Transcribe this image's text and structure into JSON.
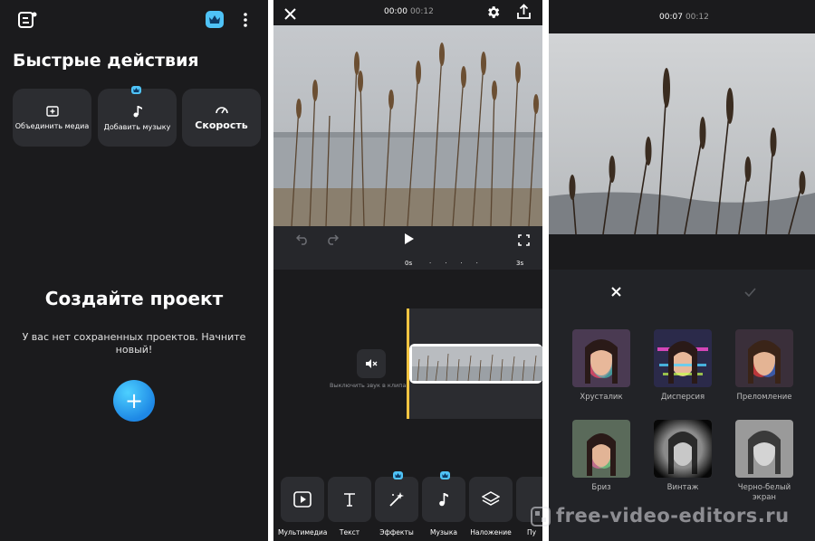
{
  "screen1": {
    "quick_actions_title": "Быстрые действия",
    "actions": [
      {
        "label": "Объединить медиа"
      },
      {
        "label": "Добавить музыку"
      },
      {
        "label": "Скорость"
      }
    ],
    "empty_title": "Создайте проект",
    "empty_text": "У вас нет сохраненных проектов. Начните новый!",
    "fab_label": "+"
  },
  "screen2": {
    "time_current": "00:00",
    "time_total": "00:12",
    "ruler_start": "0s",
    "ruler_end": "3s",
    "mute_label": "Выключить звук в клипах",
    "tools": [
      {
        "label": "Мультимедиа"
      },
      {
        "label": "Текст"
      },
      {
        "label": "Эффекты"
      },
      {
        "label": "Музыка"
      },
      {
        "label": "Наложение"
      },
      {
        "label": "Пу"
      }
    ]
  },
  "screen3": {
    "time_current": "00:07",
    "time_total": "00:12",
    "effects": [
      {
        "label": "Хрусталик"
      },
      {
        "label": "Дисперсия"
      },
      {
        "label": "Преломление"
      },
      {
        "label": "Бриз"
      },
      {
        "label": "Винтаж"
      },
      {
        "label": "Черно-белый экран"
      }
    ]
  },
  "watermark": "free-video-editors.ru",
  "colors": {
    "background": "#1b1b1d",
    "card": "#2c2d31",
    "accent": "#4fc3f7",
    "playhead": "#f5c542"
  }
}
